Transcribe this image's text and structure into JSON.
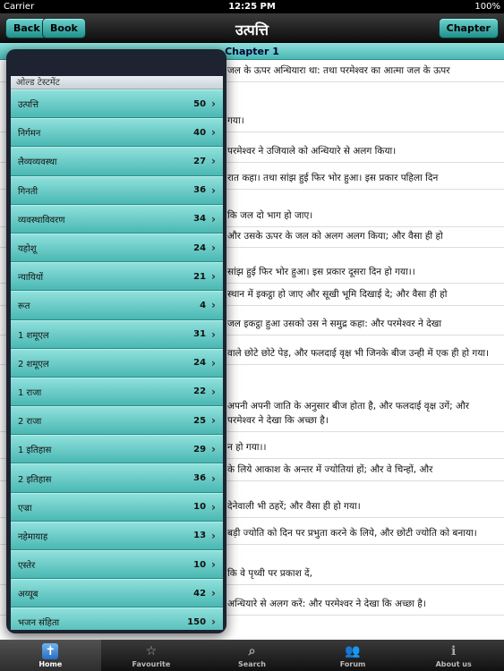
{
  "status": {
    "carrier": "Carrier",
    "time": "12:25 PM",
    "battery": "100%"
  },
  "nav": {
    "back": "Back",
    "book": "Book",
    "title": "उत्पत्ति",
    "chapter": "Chapter"
  },
  "chapter_label": "Chapter 1",
  "verses": [
    "जल के ऊपर अन्धियारा था: तथा परमेश्वर का आत्मा जल के ऊपर",
    "गया।",
    "परमेश्वर ने उजियाले को अन्धियारे से अलग किया।",
    "रात कहा। तथा सांझ हुई फिर भोर हुआ। इस प्रकार पहिला दिन",
    "कि जल दो भाग हो जाए।",
    "और उसके ऊपर के जल को अलग अलग किया; और वैसा ही हो",
    "सांझ हुई फिर भोर हुआ। इस प्रकार दूसरा दिन हो गया।।",
    "स्थान में इकट्ठा हो जाए और सूखी भूमि दिखाई दे; और वैसा ही हो",
    "जल इकट्ठा हुआ उसको उस ने समुद्र कहा: और परमेश्वर ने देखा",
    "वाले छोटे छोटे पेड़, और फलदाई वृक्ष भी जिनके बीज उन्ही में एक ही हो गया।",
    "अपनी अपनी जाति के अनुसार बीज होता है, और फलदाई वृक्ष उगें; और परमेश्वर ने देखा कि अच्छा है।",
    "न हो गया।।",
    "के लिये आकाश के अन्तर में ज्योतियां हों; और वे चिन्हों, और",
    "देनेवाली भी ठहरें; और वैसा ही हो गया।",
    "बड़ी ज्योति को दिन पर प्रभुता करने के लिये, और छोटी ज्योति को बनाया।",
    "कि वे पृथ्वी पर प्रकाश दें,",
    "अन्धियारे से अलग करें: और परमेश्वर ने देखा कि अच्छा है।"
  ],
  "book_list": {
    "section_header": "ओल्ड टेस्टमेंट",
    "books": [
      {
        "name": "उत्पत्ति",
        "chapters": "50"
      },
      {
        "name": "निर्गमन",
        "chapters": "40"
      },
      {
        "name": "लैव्यव्यवस्था",
        "chapters": "27"
      },
      {
        "name": "गिनती",
        "chapters": "36"
      },
      {
        "name": "व्यवस्थाविवरण",
        "chapters": "34"
      },
      {
        "name": "यहोशू",
        "chapters": "24"
      },
      {
        "name": "न्यायियों",
        "chapters": "21"
      },
      {
        "name": "रूत",
        "chapters": "4"
      },
      {
        "name": "1 शमूएल",
        "chapters": "31"
      },
      {
        "name": "2 शमूएल",
        "chapters": "24"
      },
      {
        "name": "1 राजा",
        "chapters": "22"
      },
      {
        "name": "2 राजा",
        "chapters": "25"
      },
      {
        "name": "1 इतिहास",
        "chapters": "29"
      },
      {
        "name": "2 इतिहास",
        "chapters": "36"
      },
      {
        "name": "एज्रा",
        "chapters": "10"
      },
      {
        "name": "नहेमायाह",
        "chapters": "13"
      },
      {
        "name": "एस्तेर",
        "chapters": "10"
      },
      {
        "name": "अय्यूब",
        "chapters": "42"
      },
      {
        "name": "भजन संहिता",
        "chapters": "150"
      }
    ]
  },
  "tabs": [
    {
      "label": "Home",
      "icon": "bible-icon"
    },
    {
      "label": "Favourite",
      "icon": "star-icon"
    },
    {
      "label": "Search",
      "icon": "search-icon"
    },
    {
      "label": "Forum",
      "icon": "people-icon"
    },
    {
      "label": "About us",
      "icon": "info-icon"
    }
  ]
}
